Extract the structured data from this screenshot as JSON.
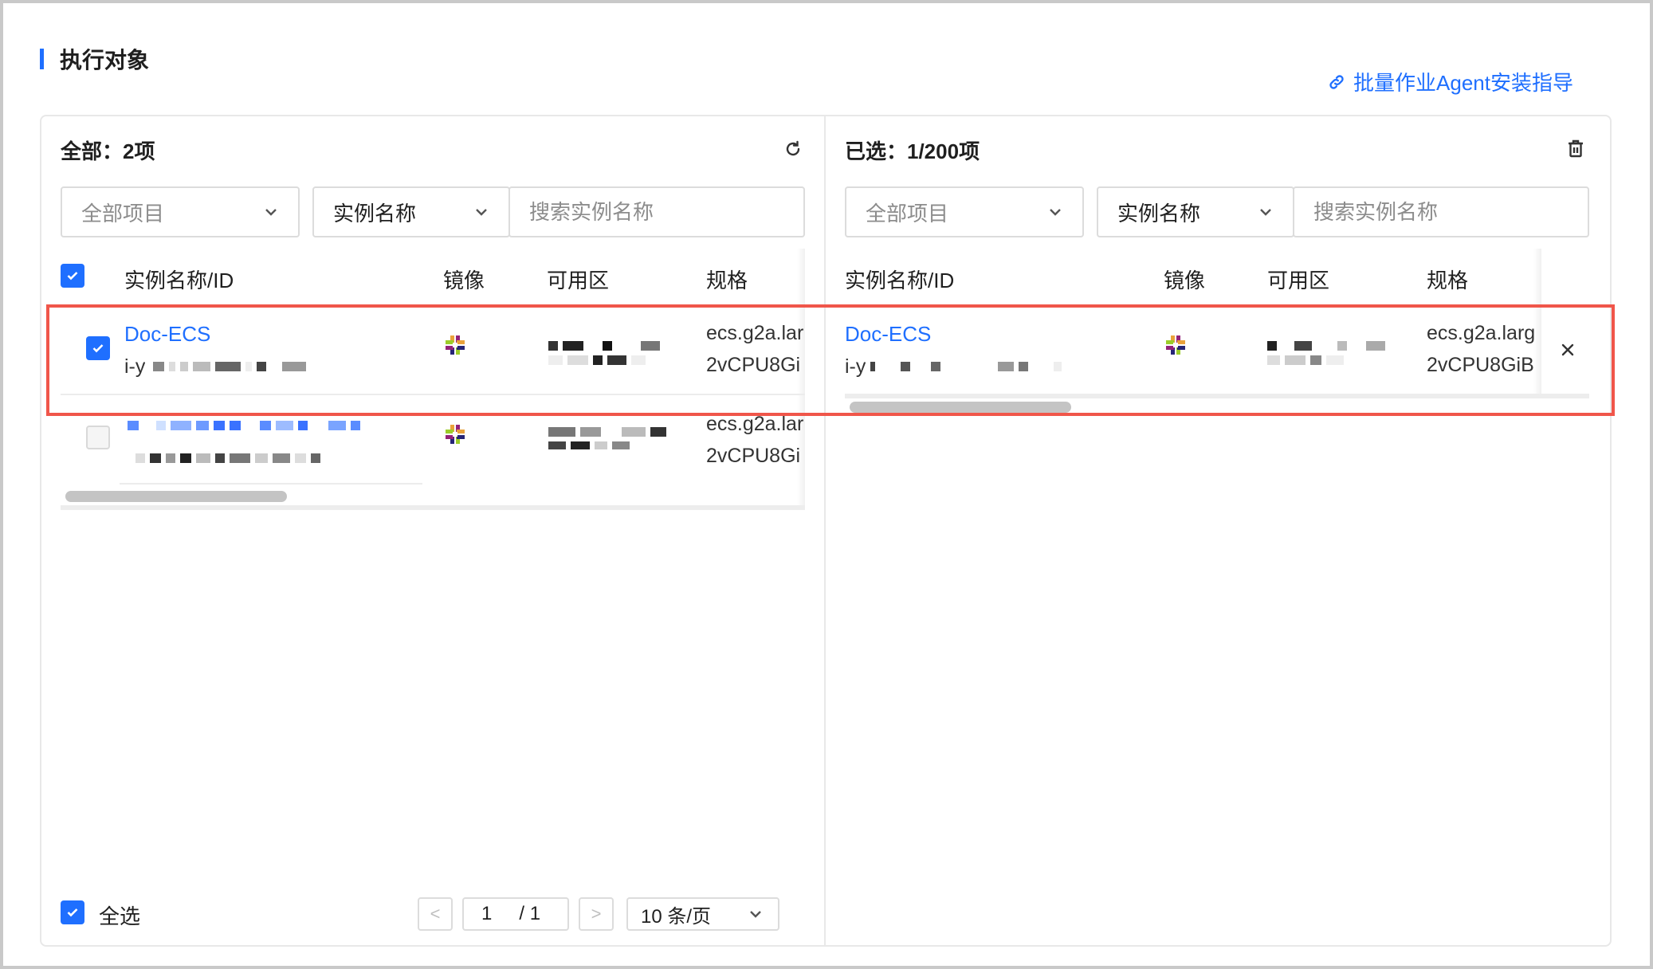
{
  "section": {
    "title": "执行对象"
  },
  "guide_link": {
    "label": "批量作业Agent安装指导"
  },
  "left": {
    "count_label": "全部：2项",
    "filter_project": "全部项目",
    "filter_field": "实例名称",
    "search_placeholder": "搜索实例名称",
    "headers": [
      "实例名称/ID",
      "镜像",
      "可用区",
      "规格"
    ],
    "rows": [
      {
        "name": "Doc-ECS",
        "id_prefix": "i-y",
        "spec_line1": "ecs.g2a.lar",
        "spec_line2": "2vCPU8Gi",
        "checked": true
      },
      {
        "name": "",
        "id_prefix": "",
        "spec_line1": "ecs.g2a.lar",
        "spec_line2": "2vCPU8Gi",
        "checked": false
      }
    ],
    "select_all_label": "全选",
    "pager": {
      "current": "1",
      "total": "/ 1",
      "page_size": "10 条/页",
      "prev": "<",
      "next": ">"
    }
  },
  "right": {
    "count_label": "已选：1/200项",
    "filter_project": "全部项目",
    "filter_field": "实例名称",
    "search_placeholder": "搜索实例名称",
    "headers": [
      "实例名称/ID",
      "镜像",
      "可用区",
      "规格"
    ],
    "rows": [
      {
        "name": "Doc-ECS",
        "id_prefix": "i-y",
        "spec_line1": "ecs.g2a.larg",
        "spec_line2": "2vCPU8GiB"
      }
    ]
  },
  "colors": {
    "accent": "#1f6fff",
    "highlight": "#f0564a"
  },
  "icons": [
    "link-icon",
    "refresh-icon",
    "trash-icon",
    "chevron-down-icon",
    "check-icon",
    "close-icon",
    "centos-icon"
  ]
}
